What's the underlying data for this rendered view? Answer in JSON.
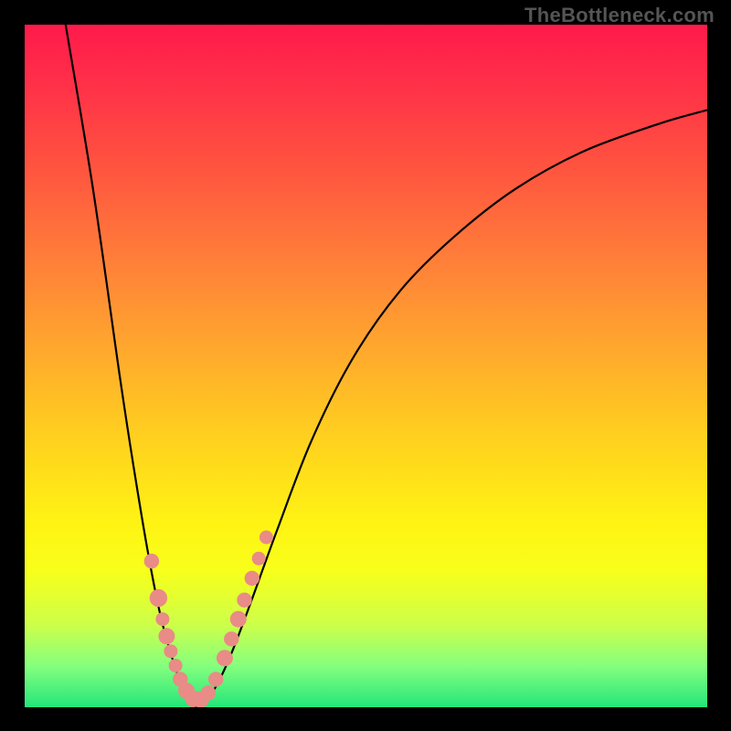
{
  "watermark": "TheBottleneck.com",
  "colors": {
    "frame": "#000000",
    "curve": "#000000",
    "marker": "#e98b86",
    "gradient_stops": [
      {
        "t": 0.0,
        "hex": "#ff1a4a"
      },
      {
        "t": 0.08,
        "hex": "#ff2e49"
      },
      {
        "t": 0.2,
        "hex": "#ff5140"
      },
      {
        "t": 0.33,
        "hex": "#ff7a3a"
      },
      {
        "t": 0.46,
        "hex": "#ffa32f"
      },
      {
        "t": 0.6,
        "hex": "#ffcf1f"
      },
      {
        "t": 0.73,
        "hex": "#fff314"
      },
      {
        "t": 0.8,
        "hex": "#f8ff1a"
      },
      {
        "t": 0.88,
        "hex": "#ccff4a"
      },
      {
        "t": 0.94,
        "hex": "#84ff7e"
      },
      {
        "t": 1.0,
        "hex": "#23e67a"
      }
    ]
  },
  "chart_data": {
    "type": "line",
    "title": "",
    "xlabel": "",
    "ylabel": "",
    "xlim": [
      0,
      1
    ],
    "ylim": [
      0,
      1
    ],
    "note": "Axis scales not labeled in image; values are normalized 0..1 (x left→right, y bottom→top).",
    "series": [
      {
        "name": "curve",
        "x": [
          0.06,
          0.1,
          0.14,
          0.16,
          0.18,
          0.2,
          0.22,
          0.235,
          0.25,
          0.275,
          0.3,
          0.33,
          0.37,
          0.42,
          0.48,
          0.55,
          0.63,
          0.72,
          0.82,
          0.93,
          1.0
        ],
        "y": [
          1.0,
          0.76,
          0.48,
          0.35,
          0.23,
          0.13,
          0.06,
          0.022,
          0.0,
          0.022,
          0.072,
          0.15,
          0.26,
          0.39,
          0.51,
          0.61,
          0.69,
          0.76,
          0.815,
          0.855,
          0.875
        ]
      }
    ],
    "markers": {
      "name": "cluster points (salmon)",
      "points": [
        {
          "x": 0.186,
          "y": 0.214,
          "r": 0.011
        },
        {
          "x": 0.196,
          "y": 0.16,
          "r": 0.013
        },
        {
          "x": 0.202,
          "y": 0.129,
          "r": 0.01
        },
        {
          "x": 0.208,
          "y": 0.104,
          "r": 0.012
        },
        {
          "x": 0.214,
          "y": 0.082,
          "r": 0.01
        },
        {
          "x": 0.221,
          "y": 0.061,
          "r": 0.01
        },
        {
          "x": 0.228,
          "y": 0.041,
          "r": 0.011
        },
        {
          "x": 0.237,
          "y": 0.024,
          "r": 0.012
        },
        {
          "x": 0.247,
          "y": 0.012,
          "r": 0.012
        },
        {
          "x": 0.258,
          "y": 0.011,
          "r": 0.012
        },
        {
          "x": 0.269,
          "y": 0.021,
          "r": 0.011
        },
        {
          "x": 0.28,
          "y": 0.041,
          "r": 0.011
        },
        {
          "x": 0.293,
          "y": 0.072,
          "r": 0.012
        },
        {
          "x": 0.303,
          "y": 0.1,
          "r": 0.011
        },
        {
          "x": 0.313,
          "y": 0.129,
          "r": 0.012
        },
        {
          "x": 0.322,
          "y": 0.157,
          "r": 0.011
        },
        {
          "x": 0.333,
          "y": 0.189,
          "r": 0.011
        },
        {
          "x": 0.343,
          "y": 0.218,
          "r": 0.01
        },
        {
          "x": 0.354,
          "y": 0.249,
          "r": 0.01
        }
      ]
    }
  }
}
